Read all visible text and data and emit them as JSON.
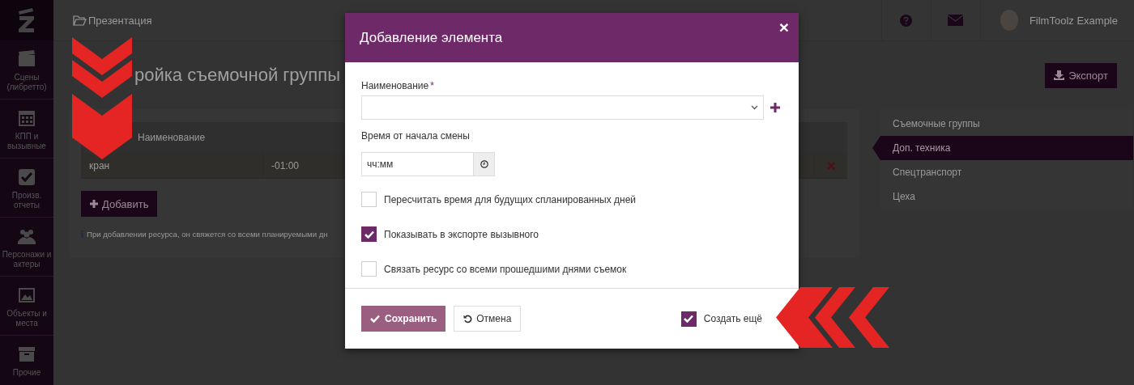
{
  "sidebar": {
    "items": [
      {
        "label": "Сцены (либретто)"
      },
      {
        "label": "КПП и вызывные"
      },
      {
        "label": "Произв. отчеты"
      },
      {
        "label": "Персонажи и актеры"
      },
      {
        "label": "Объекты и места"
      },
      {
        "label": "Прочие"
      }
    ]
  },
  "topbar": {
    "breadcrumb": "Презентация",
    "user_name": "FilmToolz Example"
  },
  "page": {
    "title": "ройка съемочной группы",
    "export_button": "Экспорт",
    "table": {
      "columns": [
        "Наименование"
      ],
      "rows": [
        {
          "cells": [
            "кран",
            "-01:00"
          ]
        }
      ]
    },
    "add_button": "Добавить",
    "info_text": "При добавлении ресурса, он свяжется со всеми планируемыми дн"
  },
  "side_tabs": [
    {
      "label": "Съемочные группы",
      "selected": false
    },
    {
      "label": "Доп. техника",
      "selected": true
    },
    {
      "label": "Спецтранспорт",
      "selected": false
    },
    {
      "label": "Цеха",
      "selected": false
    }
  ],
  "modal": {
    "title": "Добавление элемента",
    "close": "×",
    "name_label": "Наименование",
    "required_mark": "*",
    "time_label": "Время от начала смены",
    "time_placeholder": "чч:мм",
    "checkboxes": [
      {
        "label": "Пересчитать время для будущих спланированных дней",
        "checked": false
      },
      {
        "label": "Показывать в экспорте вызывного",
        "checked": true
      },
      {
        "label": "Связать ресурс со всеми прошедшими днями съемок",
        "checked": false
      }
    ],
    "save_button": "Сохранить",
    "cancel_button": "Отмена",
    "create_more": {
      "label": "Создать ещё",
      "checked": true
    }
  }
}
